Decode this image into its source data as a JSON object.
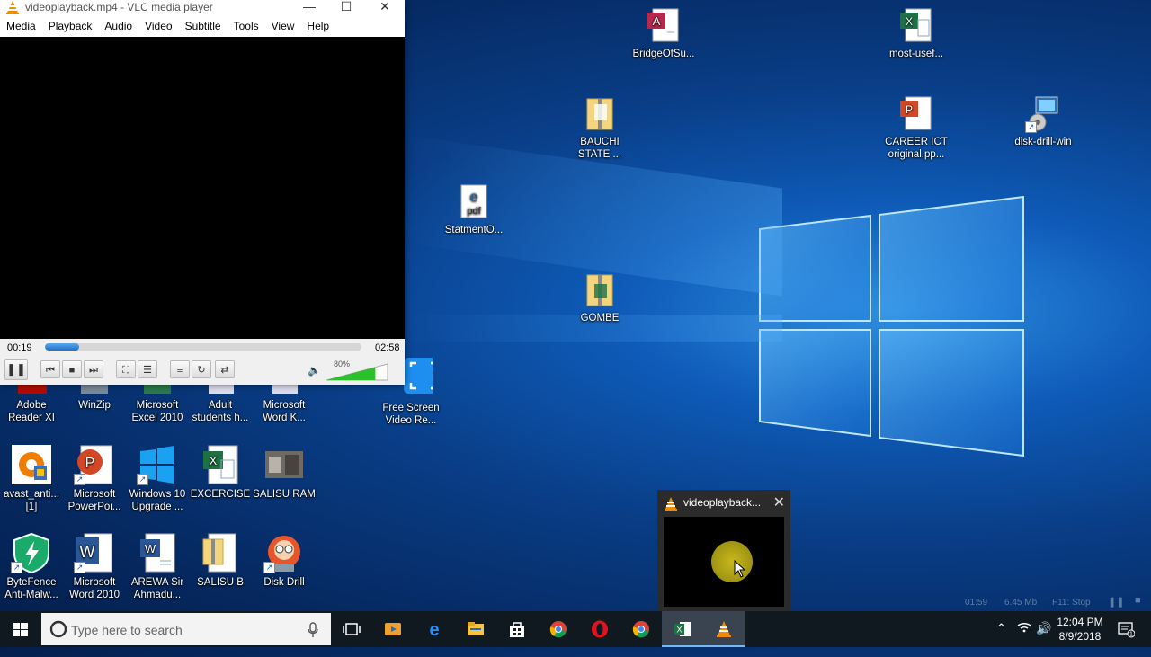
{
  "vlc": {
    "title": "videoplayback.mp4 - VLC media player",
    "menu": [
      "Media",
      "Playback",
      "Audio",
      "Video",
      "Subtitle",
      "Tools",
      "View",
      "Help"
    ],
    "elapsed": "00:19",
    "duration": "02:58",
    "progress_fraction": 0.107,
    "volume_label": "80%",
    "volume_fraction": 0.8
  },
  "desktop_icons": {
    "bridge": "BridgeOfSu...",
    "mostuse": "most-usef...",
    "bauchi_1": "BAUCHI",
    "bauchi_2": "STATE ...",
    "career_1": "CAREER ICT",
    "career_2": "original.pp...",
    "diskdrill_win": "disk-drill-win",
    "statment": "StatmentO...",
    "gombe": "GOMBE",
    "adobe_1": "Adobe",
    "adobe_2": "Reader XI",
    "winzip": "WinZip",
    "excel2010_1": "Microsoft",
    "excel2010_2": "Excel 2010",
    "adult_1": "Adult",
    "adult_2": "students h...",
    "wordk_1": "Microsoft",
    "wordk_2": "Word K...",
    "fsr_1": "Free Screen",
    "fsr_2": "Video Re...",
    "avast_1": "avast_anti...",
    "avast_2": "[1]",
    "ppt_1": "Microsoft",
    "ppt_2": "PowerPoi...",
    "win10_1": "Windows 10",
    "win10_2": "Upgrade ...",
    "excercise": "EXCERCISE",
    "salisuram": "SALISU RAM",
    "bytefence_1": "ByteFence",
    "bytefence_2": "Anti-Malw...",
    "word2010_1": "Microsoft",
    "word2010_2": "Word 2010",
    "arewa_1": "AREWA Sir",
    "arewa_2": "Ahmadu...",
    "salisub": "SALISU B",
    "diskdrill": "Disk Drill"
  },
  "thumbnail": {
    "title": "videoplayback..."
  },
  "recorder": {
    "time": "01:59",
    "size": "6.45 Mb",
    "hint": "F11: Stop"
  },
  "taskbar": {
    "search_placeholder": "Type here to search",
    "time": "12:04 PM",
    "date": "8/9/2018"
  }
}
